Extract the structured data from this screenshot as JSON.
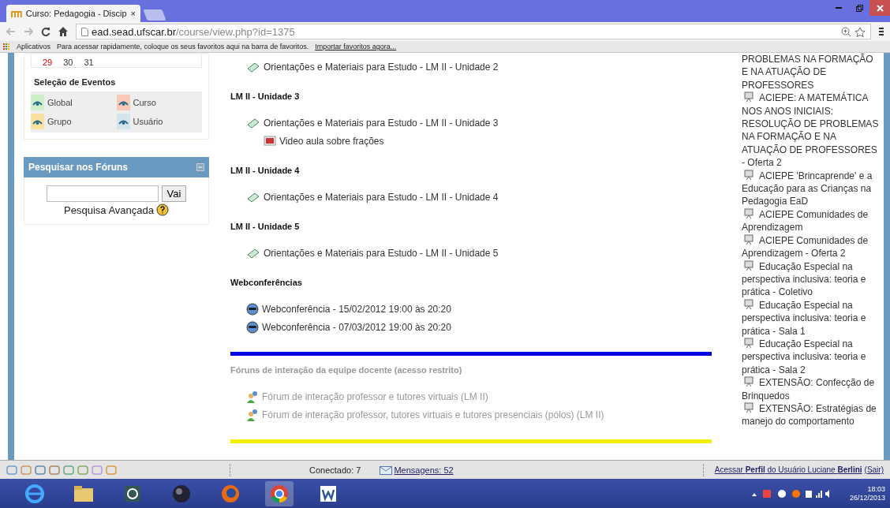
{
  "browser": {
    "tab": {
      "title": "Curso: Pedagogia - Discip",
      "close": "×"
    },
    "address": {
      "host": "ead.sead.ufscar.br",
      "path": "/course/view.php?id=1375"
    },
    "bookmarks": {
      "apps": "Aplicativos",
      "hint": "Para acessar rapidamente, coloque os seus favoritos aqui na barra de favoritos.",
      "import_link": "Importar favoritos agora..."
    }
  },
  "left": {
    "calendar_days": [
      {
        "day": "29",
        "weekend": true
      },
      {
        "day": "30",
        "weekend": false
      },
      {
        "day": "31",
        "weekend": false
      }
    ],
    "events": {
      "title": "Seleção de Eventos",
      "items": [
        {
          "label": "Global",
          "color": "#ccefc8"
        },
        {
          "label": "Curso",
          "color": "#f8c8b8"
        },
        {
          "label": "Grupo",
          "color": "#f8e0a0"
        },
        {
          "label": "Usuário",
          "color": "#d4e4ec"
        }
      ]
    },
    "forum_search": {
      "title": "Pesquisar nos Fóruns",
      "button": "Vai",
      "advanced": "Pesquisa Avançada"
    }
  },
  "sections": [
    {
      "items": [
        {
          "kind": "page",
          "label": "Orientações e Materiais para Estudo - LM II - Unidade 2",
          "indent": false
        }
      ],
      "dimmed": false
    },
    {
      "title": "LM II - Unidade 3",
      "dimmed": false,
      "items": [
        {
          "kind": "page",
          "label": "Orientações e Materiais para Estudo - LM II - Unidade 3",
          "indent": false
        },
        {
          "kind": "video",
          "label": "Video aula sobre frações",
          "indent": true
        }
      ]
    },
    {
      "title": "LM II - Unidade 4",
      "dimmed": false,
      "items": [
        {
          "kind": "page",
          "label": "Orientações e Materiais para Estudo - LM II - Unidade 4",
          "indent": false
        }
      ]
    },
    {
      "title": "LM II - Unidade 5",
      "dimmed": false,
      "items": [
        {
          "kind": "page",
          "label": "Orientações e Materiais para Estudo - LM II - Unidade 5",
          "indent": false
        }
      ]
    },
    {
      "title": "Webconferências",
      "dimmed": false,
      "items": [
        {
          "kind": "webconf",
          "label": "Webconferência - 15/02/2012 19:00 às 20:20",
          "indent": false
        },
        {
          "kind": "webconf",
          "label": "Webconferência - 07/03/2012 19:00 às 20:20",
          "indent": false
        }
      ]
    },
    {
      "title": "Fóruns de interação da equipe docente (acesso restrito)",
      "dimmed": true,
      "items": [
        {
          "kind": "forum",
          "label": "Fórum de interação professor e tutores virtuais (LM II)",
          "indent": false
        },
        {
          "kind": "forum",
          "label": "Fórum de interação professor, tutores virtuais e tutores presenciais (pólos) (LM II)",
          "indent": false
        }
      ]
    }
  ],
  "courses": [
    {
      "kind": "continued",
      "label": "PROBLEMAS NA FORMAÇÃO E NA ATUAÇÃO DE PROFESSORES"
    },
    {
      "kind": "course",
      "label": "ACIEPE: A MATEMÁTICA NOS ANOS INICIAIS: RESOLUÇÃO DE PROBLEMAS NA FORMAÇÃO E NA ATUAÇÃO DE PROFESSORES - Oferta 2"
    },
    {
      "kind": "course",
      "label": "ACIEPE 'Brincaprende' e a Educação para as Crianças na Pedagogia EaD"
    },
    {
      "kind": "course",
      "label": "ACIEPE Comunidades de Aprendizagem"
    },
    {
      "kind": "course",
      "label": "ACIEPE Comunidades de Aprendizagem - Oferta 2"
    },
    {
      "kind": "course",
      "label": "Educação Especial na perspectiva inclusiva: teoria e prática - Coletivo"
    },
    {
      "kind": "course",
      "label": "Educação Especial na perspectiva inclusiva: teoria e prática - Sala 1"
    },
    {
      "kind": "course",
      "label": "Educação Especial na perspectiva inclusiva: teoria e prática - Sala 2"
    },
    {
      "kind": "course",
      "label": "EXTENSÃO: Confecção de Brinquedos"
    },
    {
      "kind": "course",
      "label": "EXTENSÃO: Estratégias de manejo do comportamento"
    }
  ],
  "status_bar": {
    "online": "Conectado: 7",
    "messages": "Mensagens: 52",
    "profile": "Acessar **Perfil** do Usuário Luciane **Berlini**",
    "logout": "(Sair)"
  },
  "taskbar": {
    "time": "18:03",
    "date": "26/12/2013"
  }
}
